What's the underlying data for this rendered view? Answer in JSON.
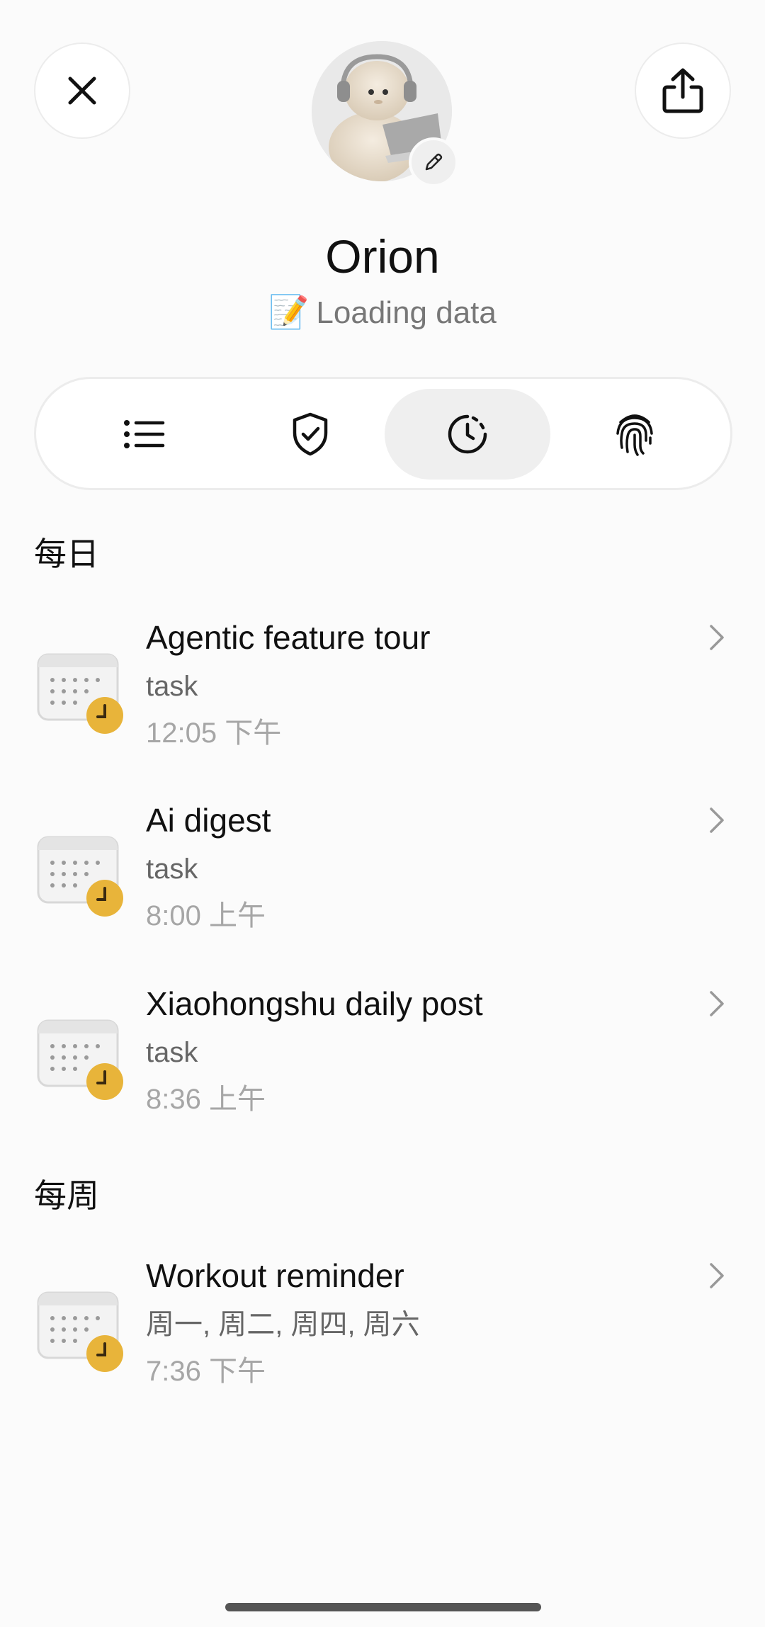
{
  "header": {
    "title": "Orion",
    "status_emoji": "📝",
    "status_text": "Loading data"
  },
  "tabs": [
    {
      "name": "list",
      "icon": "list-icon",
      "active": false
    },
    {
      "name": "security",
      "icon": "shield-check-icon",
      "active": false
    },
    {
      "name": "schedule",
      "icon": "clock-icon",
      "active": true
    },
    {
      "name": "identity",
      "icon": "fingerprint-icon",
      "active": false
    }
  ],
  "sections": [
    {
      "title": "每日",
      "items": [
        {
          "title": "Agentic feature tour",
          "subtitle": "task",
          "time": "12:05 下午"
        },
        {
          "title": "Ai digest",
          "subtitle": "task",
          "time": "8:00 上午"
        },
        {
          "title": "Xiaohongshu daily post",
          "subtitle": "task",
          "time": "8:36 上午"
        }
      ]
    },
    {
      "title": "每周",
      "items": [
        {
          "title": "Workout reminder",
          "subtitle": "周一, 周二, 周四, 周六",
          "time": "7:36 下午"
        }
      ]
    }
  ],
  "colors": {
    "accent_clock": "#e8b43a",
    "background": "#fbfbfb",
    "active_tab": "#efefef"
  }
}
